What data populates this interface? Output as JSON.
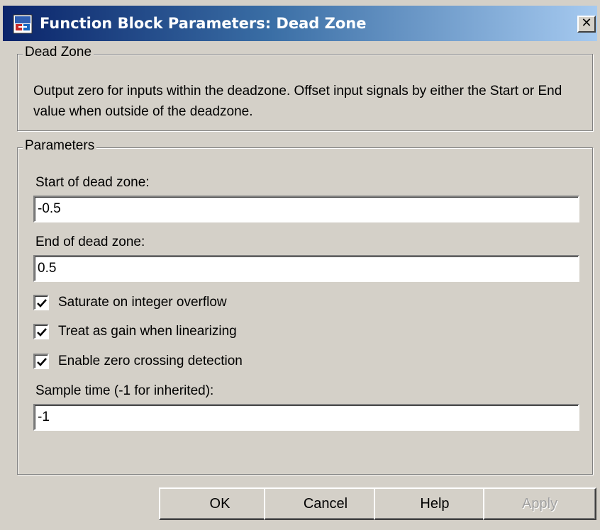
{
  "window": {
    "title": "Function Block Parameters: Dead Zone",
    "close_glyph": "×"
  },
  "description_group": {
    "legend": "Dead Zone",
    "text": "Output zero for inputs within the deadzone.  Offset input signals by either the Start or End value when outside of the deadzone."
  },
  "parameters_group": {
    "legend": "Parameters",
    "start": {
      "label": "Start of dead zone:",
      "value": "-0.5"
    },
    "end": {
      "label": "End of dead zone:",
      "value": "0.5"
    },
    "checkboxes": [
      {
        "label": "Saturate on integer overflow",
        "checked": true
      },
      {
        "label": "Treat as gain when linearizing",
        "checked": true
      },
      {
        "label": "Enable zero crossing detection",
        "checked": true
      }
    ],
    "sample_time": {
      "label": "Sample time (-1 for inherited):",
      "value": "-1"
    }
  },
  "buttons": {
    "ok": "OK",
    "cancel": "Cancel",
    "help": "Help",
    "apply": "Apply"
  },
  "colors": {
    "face": "#d4d0c8",
    "title_start": "#0a246a",
    "title_end": "#a6caf0"
  },
  "icons": {
    "app": "simulink-block-icon",
    "close": "close-icon",
    "check": "check-icon"
  }
}
